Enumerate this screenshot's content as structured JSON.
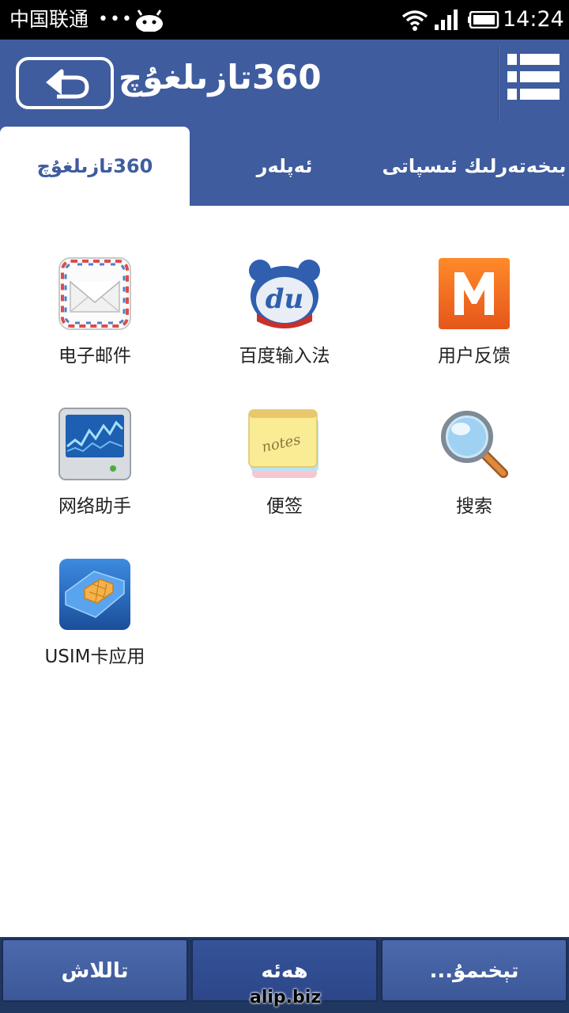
{
  "status_bar": {
    "carrier": "中国联通",
    "dots": "•••",
    "time": "14:24"
  },
  "header": {
    "title": "360تازىلغۇچ",
    "back_icon": "back-arrow-icon",
    "menu_icon": "list-menu-icon"
  },
  "tabs": [
    {
      "label": "360تازىلغۇچ",
      "active": true
    },
    {
      "label": "ئەپلەر",
      "active": false
    },
    {
      "label": "بىخەتەرلىك ئىسپاتى",
      "active": false
    }
  ],
  "apps": [
    {
      "label": "电子邮件",
      "icon": "mail-envelope-icon"
    },
    {
      "label": "百度输入法",
      "icon": "baidu-du-icon"
    },
    {
      "label": "用户反馈",
      "icon": "m-feedback-icon"
    },
    {
      "label": "网络助手",
      "icon": "network-monitor-icon"
    },
    {
      "label": "便签",
      "icon": "notes-icon"
    },
    {
      "label": "搜索",
      "icon": "magnifier-icon"
    },
    {
      "label": "USIM卡应用",
      "icon": "sim-card-icon"
    }
  ],
  "bottom_bar": {
    "left": "تاللاش",
    "middle": "ھەئە",
    "right": "تېخىمۇ..."
  },
  "watermark": "alip.biz",
  "colors": {
    "header_blue": "#3f5c9e",
    "bottom_dark": "#203760"
  }
}
